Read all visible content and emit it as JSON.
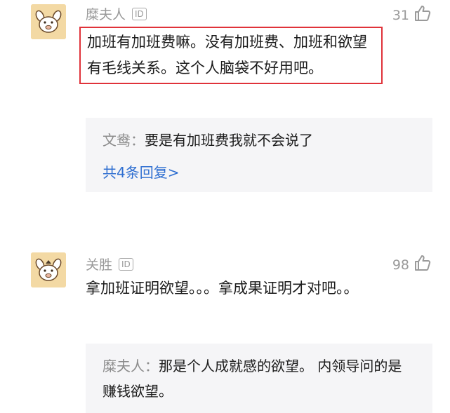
{
  "comments": [
    {
      "username": "糜夫人",
      "badge": "ID",
      "likes": "31",
      "text": "加班有加班费嘛。没有加班费、加班和欲望有毛线关系。这个人脑袋不好用吧。",
      "reply": {
        "author": "文鸯：",
        "text": "要是有加班费我就不会说了",
        "more_label": "共4条回复>"
      }
    },
    {
      "username": "关胜",
      "badge": "ID",
      "likes": "98",
      "text": "拿加班证明欲望。。。拿成果证明才对吧。。",
      "reply": {
        "author": "糜夫人：",
        "text": "那是个人成就感的欲望。 内领导问的是赚钱欲望。"
      }
    }
  ],
  "icons": {
    "avatar": "dog-face-avatar-icon",
    "like": "thumbs-up-icon"
  }
}
